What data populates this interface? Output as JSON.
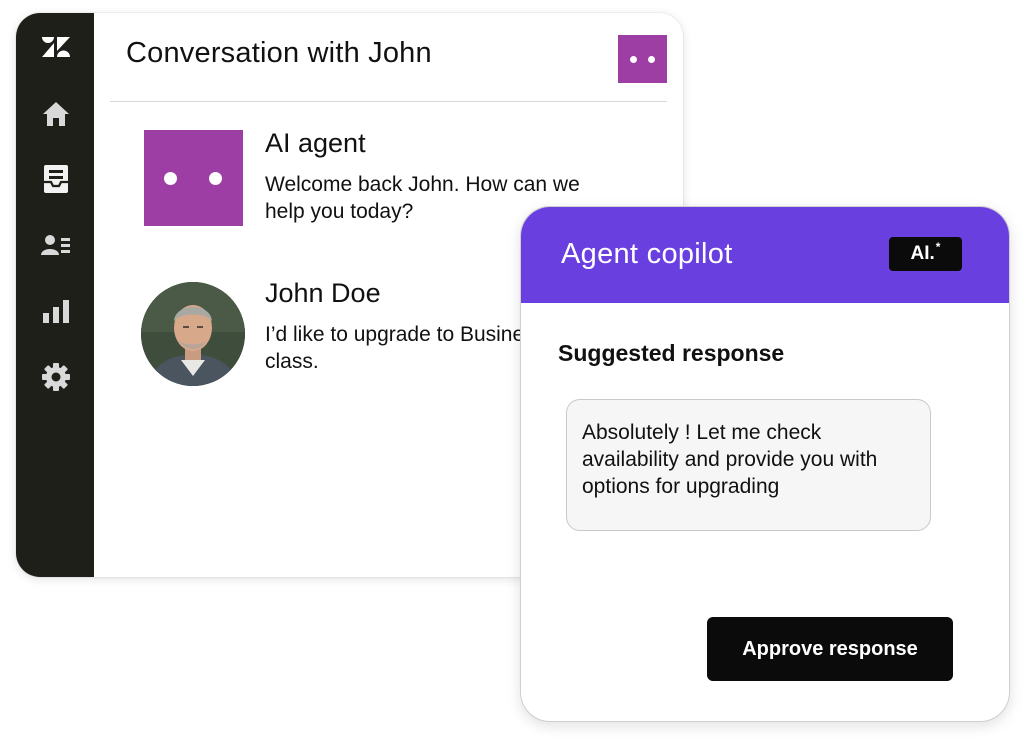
{
  "conversation": {
    "title": "Conversation with John",
    "brand_color": "#9c3ea3",
    "messages": [
      {
        "sender": "AI agent",
        "text": "Welcome back John. How can we help you today?",
        "avatar": "ai-agent-avatar"
      },
      {
        "sender": "John Doe",
        "text": "I’d like to upgrade to Business class.",
        "avatar": "user-photo"
      }
    ]
  },
  "sidebar": {
    "logo": "zendesk-logo-icon",
    "items": [
      {
        "icon": "home-icon"
      },
      {
        "icon": "inbox-icon"
      },
      {
        "icon": "contacts-icon"
      },
      {
        "icon": "reports-icon"
      },
      {
        "icon": "settings-gear-icon"
      }
    ]
  },
  "copilot": {
    "title": "Agent copilot",
    "badge": "AI.",
    "badge_sparkle": "*",
    "header_color": "#6a3fe0",
    "suggested_label": "Suggested response",
    "suggested_text": "Absolutely ! Let me check availability and provide you with options for upgrading",
    "approve_label": "Approve response"
  }
}
